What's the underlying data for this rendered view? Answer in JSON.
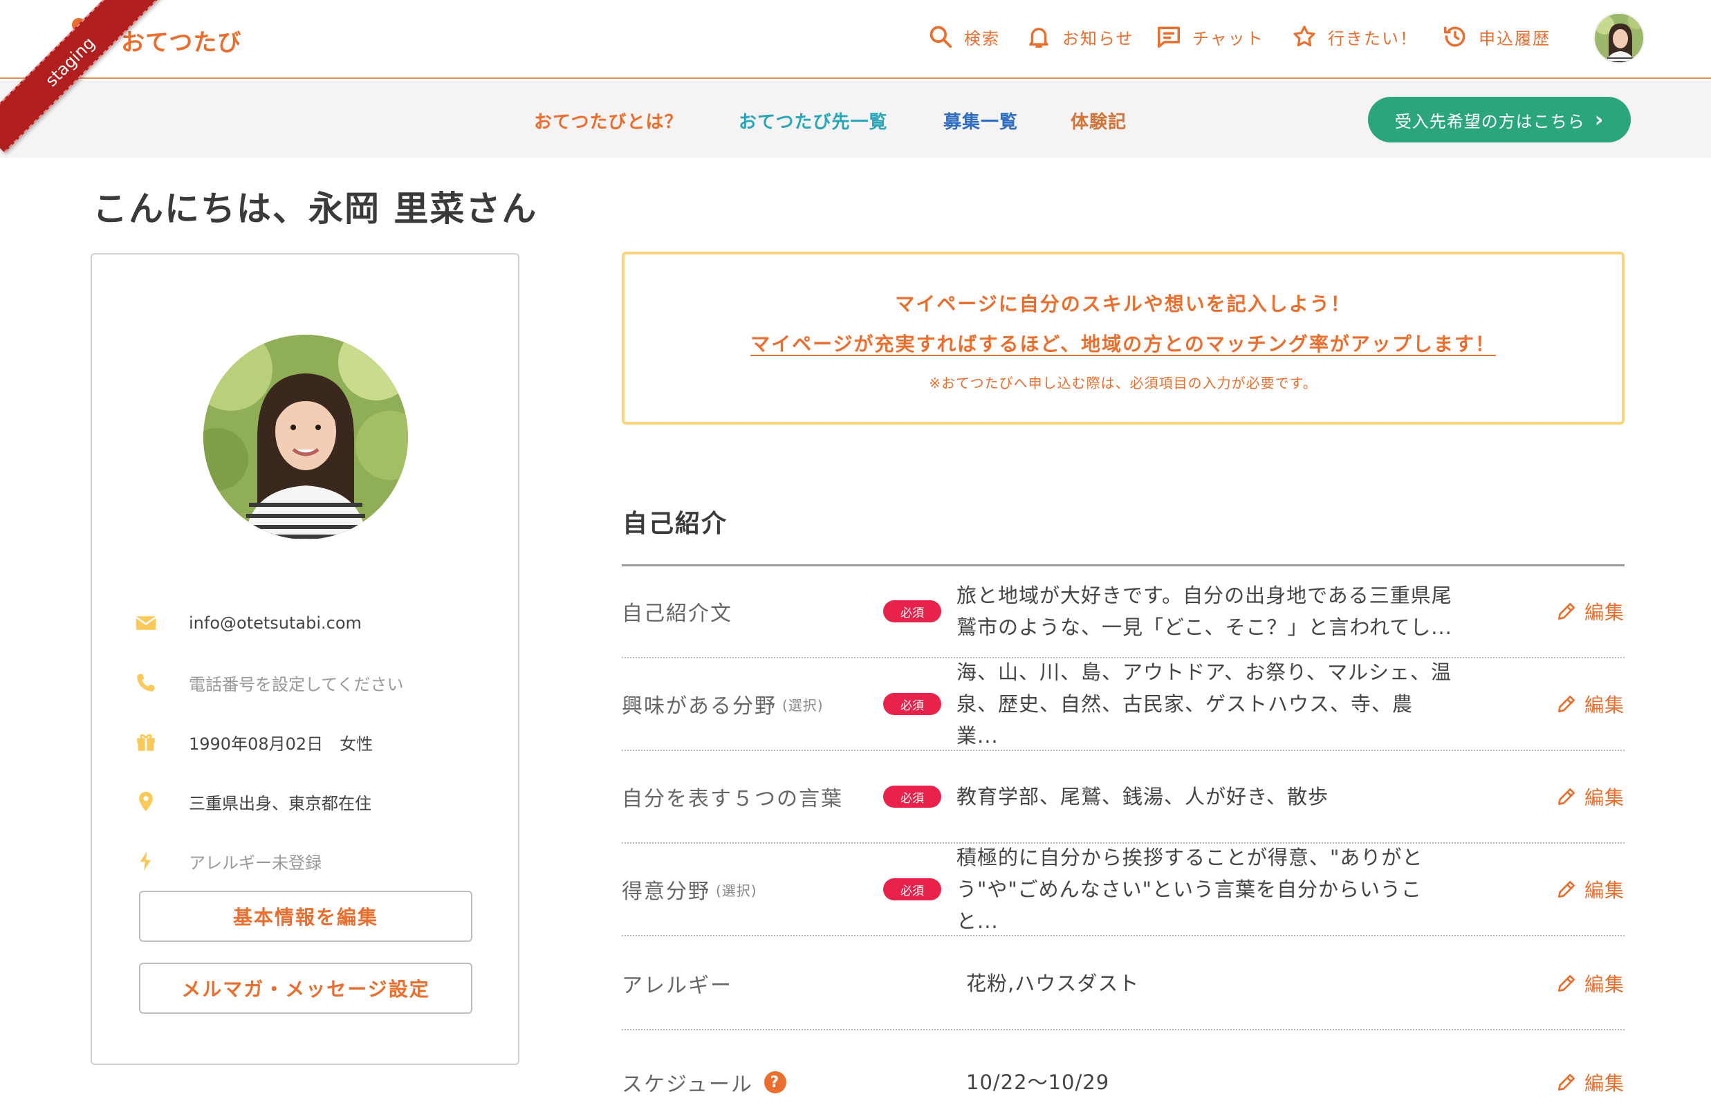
{
  "header": {
    "logo": "おてつたび",
    "ribbon": "staging",
    "nav": [
      {
        "label": "検索",
        "icon": "search-icon"
      },
      {
        "label": "お知らせ",
        "icon": "bell-icon"
      },
      {
        "label": "チャット",
        "icon": "chat-icon"
      },
      {
        "label": "行きたい！",
        "icon": "star-icon"
      },
      {
        "label": "申込履歴",
        "icon": "history-icon"
      }
    ],
    "accent": "#ea6e2d"
  },
  "subnav": {
    "items": [
      {
        "label": "おてつたびとは？",
        "color": "#ea6e2d"
      },
      {
        "label": "おてつたび先一覧",
        "color": "#2ba6b8"
      },
      {
        "label": "募集一覧",
        "color": "#2f6fc0"
      },
      {
        "label": "体験記",
        "color": "#d0743a"
      }
    ],
    "cta": "受入先希望の方はこちら",
    "cta_color": "#2ba67b"
  },
  "greeting": "こんにちは、永岡 里菜さん",
  "profile": {
    "email": "info@otetsutabi.com",
    "phone": "電話番号を設定してください",
    "birth_gender": "1990年08月02日　女性",
    "location": "三重県出身、東京都在住",
    "allergy": "アレルギー未登録",
    "edit_button": "基本情報を編集",
    "mail_button": "メルマガ・メッセージ設定"
  },
  "notice": {
    "line1": "マイページに自分のスキルや想いを記入しよう！",
    "line2": "マイページが充実すればするほど、地域の方とのマッチング率がアップします！",
    "line3": "※おてつたびへ申し込む際は、必須項目の入力が必要です。"
  },
  "section": {
    "title": "自己紹介",
    "required_badge": "必須",
    "edit_label": "編集",
    "select_note": "(選択)",
    "rows": [
      {
        "label": "自己紹介文",
        "value": "旅と地域が大好きです。自分の出身地である三重県尾鷲市のような、一見「どこ、そこ？」と言われてし..."
      },
      {
        "label": "興味がある分野",
        "value": "海、山、川、島、アウトドア、お祭り、マルシェ、温泉、歴史、自然、古民家、ゲストハウス、寺、農業..."
      },
      {
        "label": "自分を表す５つの言葉",
        "value": "教育学部、尾鷲、銭湯、人が好き、散歩"
      },
      {
        "label": "得意分野",
        "value": "積極的に自分から挨拶することが得意、\"ありがとう\"や\"ごめんなさい\"という言葉を自分からいうこと..."
      },
      {
        "label": "アレルギー",
        "value": "花粉,ハウスダスト"
      },
      {
        "label": "スケジュール",
        "value": "10/22〜10/29"
      }
    ]
  }
}
